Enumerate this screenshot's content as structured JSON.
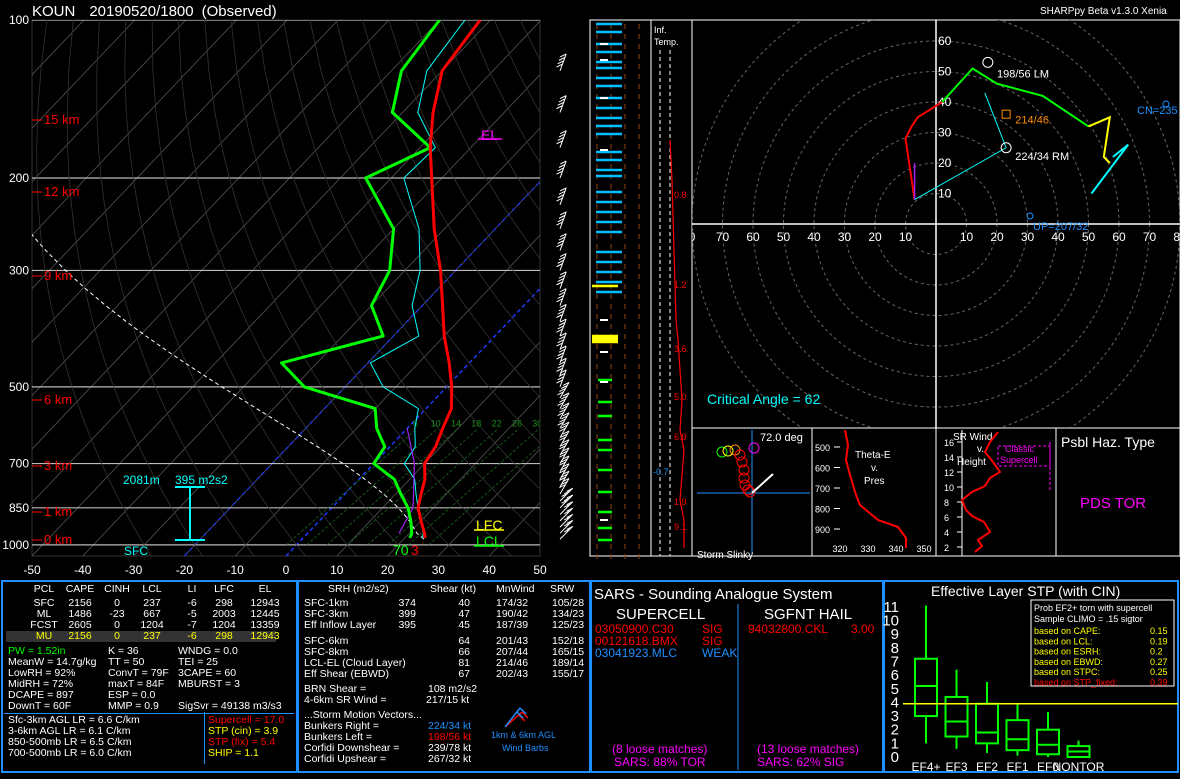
{
  "header": {
    "station": "KOUN",
    "datetime": "20190520/1800",
    "mode": "(Observed)",
    "version": "SHARPpy Beta v1.3.0 Xenia"
  },
  "skewt": {
    "pressure_ticks": [
      "100",
      "200",
      "300",
      "500",
      "700",
      "850",
      "1000"
    ],
    "temp_ticks": [
      "-50",
      "-40",
      "-30",
      "-20",
      "-10",
      "0",
      "10",
      "20",
      "30",
      "40",
      "50"
    ],
    "height_labels": [
      "15 km",
      "12 km",
      "9 km",
      "6 km",
      "3 km",
      "1 km",
      "0 km"
    ],
    "el_label": "EL",
    "lfc_label": "LFC",
    "lcl_label": "LCL",
    "sfc_label": "SFC",
    "inflow_depth_label": "2081m",
    "inflow_srh_label": "395 m2s2",
    "sfc_temp_label": "70",
    "sfc_dew_label": "3",
    "wetbulb_labels": [
      "6",
      "10",
      "14",
      "18",
      "22",
      "26",
      "30",
      "34"
    ]
  },
  "inferred_temp": {
    "title_line1": "Inf.",
    "title_line2": "Temp.",
    "values": [
      "0.8",
      "1.2",
      "3.6",
      "5.0",
      "6.9",
      "1.9",
      "9.1",
      "-0.7"
    ]
  },
  "hodograph": {
    "rings": [
      "10",
      "20",
      "30",
      "40",
      "50",
      "60",
      "70",
      "80"
    ],
    "y_ticks": [
      "60",
      "50",
      "40",
      "30",
      "20",
      "10"
    ],
    "x_ticks": [
      "0",
      "70",
      "60",
      "50",
      "40",
      "30",
      "20",
      "10",
      "10",
      "20",
      "30",
      "40",
      "50",
      "60",
      "70",
      "80"
    ],
    "lm_label": "198/56 LM",
    "rm_label": "224/34 RM",
    "mean_label": "214/46",
    "cn_label": "CN=235",
    "up_label": "UP=207/32",
    "critical_angle": "Critical Angle = 62"
  },
  "storm_slinky": {
    "deg": "72.0 deg",
    "title": "Storm Slinky"
  },
  "theta_e": {
    "title_line1": "Theta-E",
    "title_line2": "v.",
    "title_line3": "Pres",
    "y_ticks": [
      "500",
      "600",
      "700",
      "800",
      "900"
    ],
    "x_ticks": [
      "320",
      "330",
      "340",
      "350"
    ]
  },
  "srwind": {
    "title_line1": "SR Wind",
    "title_line2": "v.",
    "title_line3": "Height",
    "classic_line1": "Classic",
    "classic_line2": "Supercell",
    "y_ticks": [
      "16",
      "14",
      "12",
      "10",
      "8",
      "6",
      "4",
      "2"
    ]
  },
  "hazard": {
    "title": "Psbl Haz. Type",
    "value": "PDS TOR"
  },
  "parcels": {
    "headers": [
      "PCL",
      "CAPE",
      "CINH",
      "LCL",
      "LI",
      "LFC",
      "EL"
    ],
    "rows": [
      [
        "SFC",
        "2156",
        "0",
        "237",
        "-6",
        "298",
        "12943"
      ],
      [
        "ML",
        "1486",
        "-23",
        "667",
        "-5",
        "2003",
        "12445"
      ],
      [
        "FCST",
        "2605",
        "0",
        "1204",
        "-7",
        "1204",
        "13359"
      ],
      [
        "MU",
        "2156",
        "0",
        "237",
        "-6",
        "298",
        "12943"
      ]
    ]
  },
  "thermo": {
    "col1": [
      "PW = 1.52in",
      "MeanW = 14.7g/kg",
      "LowRH = 92%",
      "MidRH = 72%",
      "DCAPE = 897",
      "DownT = 60F"
    ],
    "col2": [
      "K = 36",
      "TT = 50",
      "ConvT = 79F",
      "maxT = 84F",
      "ESP = 0.0",
      "MMP = 0.9"
    ],
    "col3": [
      "WNDG = 0.0",
      "TEI = 25",
      "3CAPE = 60",
      "MBURST = 3",
      "",
      "SigSvr = 49138 m3/s3"
    ],
    "lapse": [
      "Sfc-3km AGL LR = 6.6 C/km",
      "3-6km AGL LR = 6.1 C/km",
      "850-500mb LR = 6.5 C/km",
      "700-500mb LR = 6.0 C/km"
    ],
    "supercell": "Supercell = 17.0",
    "stp_cin": "STP (cin) = 3.9",
    "stp_fix": "STP (fix) = 5.4",
    "ship": "SHIP = 1.1"
  },
  "kinematics": {
    "headers": [
      "SRH (m2/s2)",
      "Shear (kt)",
      "MnWind",
      "SRW"
    ],
    "rows": [
      [
        "SFC-1km",
        "374",
        "40",
        "174/32",
        "105/28"
      ],
      [
        "SFC-3km",
        "399",
        "47",
        "190/42",
        "134/23"
      ],
      [
        "Eff Inflow Layer",
        "395",
        "45",
        "187/39",
        "125/23"
      ],
      [
        "SFC-6km",
        "",
        "64",
        "201/43",
        "152/18"
      ],
      [
        "SFC-8km",
        "",
        "66",
        "207/44",
        "165/15"
      ],
      [
        "LCL-EL (Cloud Layer)",
        "",
        "81",
        "214/46",
        "189/14"
      ],
      [
        "Eff Shear (EBWD)",
        "",
        "67",
        "202/43",
        "155/17"
      ]
    ],
    "brn_shear": "BRN Shear =",
    "brn_shear_val": "108 m2/s2",
    "sr_wind": "4-6km SR Wind =",
    "sr_wind_val": "217/15 kt",
    "storm_motion": "...Storm Motion Vectors...",
    "motions": [
      [
        "Bunkers Right =",
        "224/34 kt"
      ],
      [
        "Bunkers Left =",
        "198/56 kt"
      ],
      [
        "Corfidi Downshear =",
        "239/78 kt"
      ],
      [
        "Corfidi Upshear =",
        "267/32 kt"
      ]
    ],
    "barb_caption_line1": "1km & 6km AGL",
    "barb_caption_line2": "Wind Barbs"
  },
  "sars": {
    "title": "SARS - Sounding Analogue System",
    "supercell_header": "SUPERCELL",
    "hail_header": "SGFNT HAIL",
    "supercell_matches": [
      [
        "03050900.C30",
        "SIG"
      ],
      [
        "00121618.BMX",
        "SIG"
      ],
      [
        "03041923.MLC",
        "WEAK"
      ]
    ],
    "hail_matches": [
      [
        "94032800.CKL",
        "3.00"
      ]
    ],
    "supercell_loose": "(8 loose matches)",
    "supercell_pct": "SARS: 88% TOR",
    "hail_loose": "(13 loose matches)",
    "hail_pct": "SARS: 62% SIG"
  },
  "stp_panel": {
    "title": "Effective Layer STP (with CIN)",
    "y_ticks": [
      "11",
      "10",
      "9",
      "8",
      "7",
      "6",
      "5",
      "4",
      "3",
      "2",
      "1",
      "0"
    ],
    "categories": [
      "EF4+",
      "EF3",
      "EF2",
      "EF1",
      "EF0",
      "NONTOR"
    ],
    "prob_line1": "Prob EF2+ torn with supercell",
    "prob_line2": "Sample CLIMO = .15 sigtor",
    "based": [
      [
        "based on CAPE:",
        "0.15"
      ],
      [
        "based on LCL:",
        "0.19"
      ],
      [
        "based on ESRH:",
        "0.2"
      ],
      [
        "based on EBWD:",
        "0.27"
      ],
      [
        "based on STPC:",
        "0.25"
      ],
      [
        "based on STP_fixed:",
        "0.39"
      ]
    ]
  },
  "colors": {
    "temp": "#ff0000",
    "dew": "#00ff00",
    "wetbulb": "#00ffff",
    "parcel": "#ffffff",
    "panel_border": "#1e90ff",
    "stp_box": "#00ff00",
    "hazard": "#ff00ff"
  },
  "chart_data": [
    {
      "type": "line",
      "title": "Skew-T Log-P",
      "xlabel": "Temperature (C)",
      "ylabel": "Pressure (mb)",
      "xlim": [
        -50,
        50
      ],
      "ylim": [
        1000,
        100
      ],
      "y_scale": "log",
      "series": [
        {
          "name": "Temperature",
          "p": [
            970,
            950,
            900,
            850,
            800,
            750,
            700,
            650,
            600,
            550,
            500,
            450,
            400,
            350,
            300,
            250,
            200,
            175,
            150,
            125,
            100
          ],
          "t": [
            24,
            23,
            20,
            17,
            15,
            13,
            10,
            9,
            7,
            5,
            1,
            -4,
            -10,
            -16,
            -23,
            -32,
            -42,
            -48,
            -54,
            -60,
            -62
          ]
        },
        {
          "name": "Dewpoint",
          "p": [
            970,
            950,
            900,
            850,
            800,
            750,
            700,
            650,
            600,
            550,
            500,
            450,
            400,
            350,
            300,
            250,
            200,
            175,
            150,
            125,
            100
          ],
          "t": [
            21,
            20.5,
            18,
            15,
            11,
            7,
            0,
            -1,
            -6,
            -10,
            -28,
            -37,
            -22,
            -30,
            -33,
            -40,
            -55,
            -48,
            -62,
            -68,
            -70
          ]
        }
      ]
    },
    {
      "type": "scatter",
      "title": "Effective Layer STP (with CIN)",
      "categories": [
        "EF4+",
        "EF3",
        "EF2",
        "EF1",
        "EF0",
        "NONTOR"
      ],
      "box_low": [
        3.0,
        1.0,
        0.6,
        0.4,
        0.1,
        0.0
      ],
      "box_q1": [
        3.0,
        1.5,
        1.0,
        0.5,
        0.2,
        0.0
      ],
      "box_median": [
        5.2,
        2.6,
        1.8,
        1.3,
        0.9,
        0.4
      ],
      "box_q3": [
        7.2,
        4.4,
        3.9,
        2.7,
        2.0,
        0.8
      ],
      "whisker_high": [
        11.1,
        6.4,
        5.5,
        3.9,
        3.3,
        1.2
      ],
      "whisker_low": [
        1.0,
        0.6,
        0.3,
        0.1,
        0.0,
        0.0
      ],
      "ylim": [
        0,
        11
      ],
      "current_value": 3.9
    }
  ]
}
